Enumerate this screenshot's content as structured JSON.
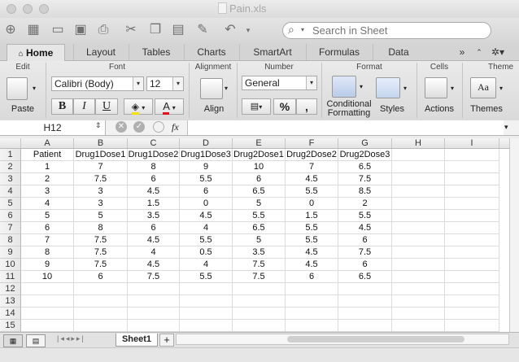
{
  "window": {
    "title": "Pain.xls"
  },
  "toolbar": {
    "search_placeholder": "Search in Sheet"
  },
  "ribbon_tabs": [
    "Home",
    "Layout",
    "Tables",
    "Charts",
    "SmartArt",
    "Formulas",
    "Data"
  ],
  "ribbon_groups": {
    "edit": "Edit",
    "font": "Font",
    "alignment": "Alignment",
    "number": "Number",
    "format": "Format",
    "cells": "Cells",
    "themes": "Theme"
  },
  "ribbon": {
    "paste_label": "Paste",
    "font_name": "Calibri (Body)",
    "font_size": "12",
    "bold": "B",
    "italic": "I",
    "underline": "U",
    "align_label": "Align",
    "number_format": "General",
    "percent": "%",
    "comma": ",",
    "conditional_label_1": "Conditional",
    "conditional_label_2": "Formatting",
    "styles_label": "Styles",
    "actions_label": "Actions",
    "themes_label": "Themes",
    "themes_icon_text": "Aa"
  },
  "formula_bar": {
    "cell_ref": "H12",
    "fx": "fx",
    "value": ""
  },
  "sheet": {
    "columns": [
      "A",
      "B",
      "C",
      "D",
      "E",
      "F",
      "G",
      "H",
      "I"
    ],
    "rows": [
      "1",
      "2",
      "3",
      "4",
      "5",
      "6",
      "7",
      "8",
      "9",
      "10",
      "11",
      "12",
      "13",
      "14",
      "15"
    ],
    "cells": [
      [
        "Patient",
        "Drug1Dose1",
        "Drug1Dose2",
        "Drug1Dose3",
        "Drug2Dose1",
        "Drug2Dose2",
        "Drug2Dose3"
      ],
      [
        "1",
        "7",
        "8",
        "9",
        "10",
        "7",
        "6.5"
      ],
      [
        "2",
        "7.5",
        "6",
        "5.5",
        "6",
        "4.5",
        "7.5"
      ],
      [
        "3",
        "3",
        "4.5",
        "6",
        "6.5",
        "5.5",
        "8.5"
      ],
      [
        "4",
        "3",
        "1.5",
        "0",
        "5",
        "0",
        "2"
      ],
      [
        "5",
        "5",
        "3.5",
        "4.5",
        "5.5",
        "1.5",
        "5.5"
      ],
      [
        "6",
        "8",
        "6",
        "4",
        "6.5",
        "5.5",
        "4.5"
      ],
      [
        "7",
        "7.5",
        "4.5",
        "5.5",
        "5",
        "5.5",
        "6"
      ],
      [
        "8",
        "7.5",
        "4",
        "0.5",
        "3.5",
        "4.5",
        "7.5"
      ],
      [
        "9",
        "7.5",
        "4.5",
        "4",
        "7.5",
        "4.5",
        "6"
      ],
      [
        "10",
        "6",
        "7.5",
        "5.5",
        "7.5",
        "6",
        "6.5"
      ]
    ]
  },
  "sheet_tabs": [
    "Sheet1"
  ],
  "add_sheet": "+"
}
